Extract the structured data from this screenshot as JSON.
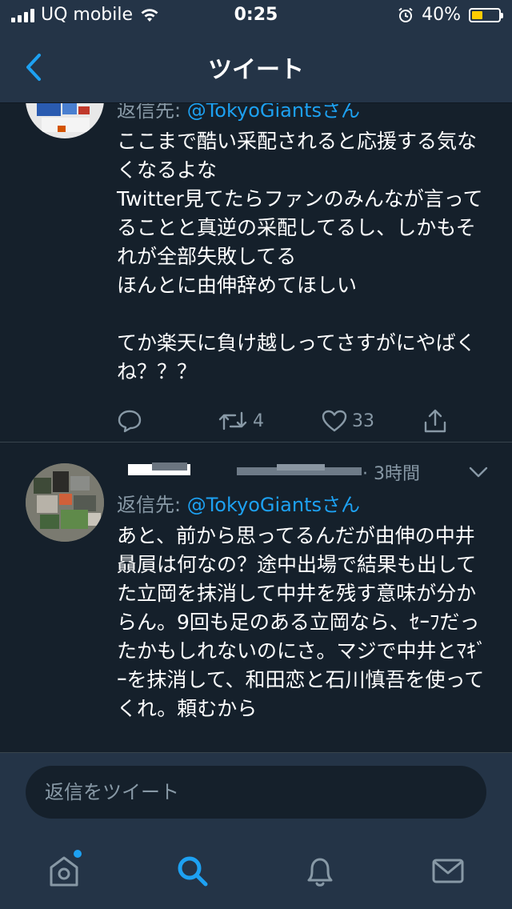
{
  "status_bar": {
    "carrier": "UQ mobile",
    "time": "0:25",
    "battery_percent": "40%",
    "battery_level": 0.4,
    "battery_color": "#ffcc00"
  },
  "nav": {
    "title": "ツイート",
    "back_icon": "chevron-left-icon"
  },
  "timeline": {
    "tweets": [
      {
        "reply_to_prefix": "返信先: ",
        "reply_to_mention": "@TokyoGiantsさん",
        "text": "ここまで酷い采配されると応援する気なくなるよな\nTwitter見てたらファンのみんなが言ってることと真逆の采配してるし、しかもそれが全部失敗してる\nほんとに由伸辞めてほしい\n\nてか楽天に負け越しってさすがにやばくね？？？",
        "replies": "",
        "retweets": "4",
        "likes": "33"
      },
      {
        "time": "· 3時間",
        "reply_to_prefix": "返信先: ",
        "reply_to_mention": "@TokyoGiantsさん",
        "text": "あと、前から思ってるんだが由伸の中井贔屓は何なの？途中出場で結果も出してた立岡を抹消して中井を残す意味が分からん。9回も足のある立岡なら、ｾｰﾌだったかもしれないのにさ。マジで中井とﾏｷﾞｰを抹消して、和田恋と石川慎吾を使ってくれ。頼むから"
      }
    ]
  },
  "compose": {
    "placeholder": "返信をツイート"
  },
  "tabbar": {
    "items": [
      "home-icon",
      "search-icon",
      "notifications-icon",
      "messages-icon"
    ],
    "active": "search-icon",
    "accent_color": "#1da1f2",
    "home_has_new_dot": true
  },
  "colors": {
    "background": "#15202b",
    "bar": "#243447",
    "secondary_text": "#8899a6",
    "accent": "#1da1f2",
    "divider": "#38444d"
  }
}
